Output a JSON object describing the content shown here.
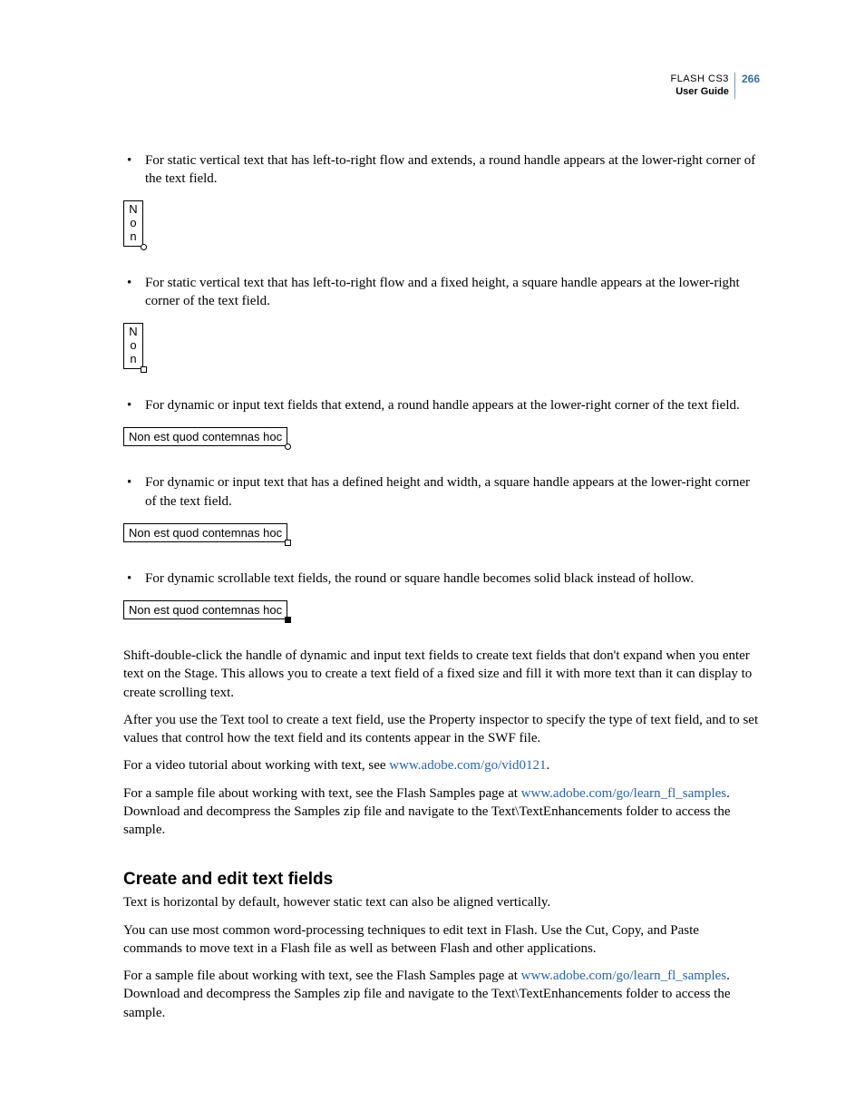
{
  "header": {
    "product": "FLASH CS3",
    "guide": "User Guide",
    "page": "266"
  },
  "bullets": {
    "b1": "For static vertical text that has left-to-right flow and extends, a round handle appears at the lower-right corner of the text field.",
    "b2": "For static vertical text that has left-to-right flow and a fixed height, a square handle appears at the lower-right corner of the text field.",
    "b3": "For dynamic or input text fields that extend, a round handle appears at the lower-right corner of the text field.",
    "b4": "For dynamic or input text that has a defined height and width, a square handle appears at the lower-right corner of the text field.",
    "b5": "For dynamic scrollable text fields, the round or square handle becomes solid black instead of hollow."
  },
  "figs": {
    "vertN": "N",
    "vertO": "o",
    "vertn": "n",
    "horiz": "Non est quod contemnas hoc"
  },
  "paras": {
    "p1": "Shift-double-click the handle of dynamic and input text fields to create text fields that don't expand when you enter text on the Stage. This allows you to create a text field of a fixed size and fill it with more text than it can display to create scrolling text.",
    "p2": "After you use the Text tool to create a text field, use the Property inspector to specify the type of text field, and to set values that control how the text field and its contents appear in the SWF file.",
    "p3a": "For a video tutorial about working with text, see ",
    "p3link": "www.adobe.com/go/vid0121",
    "p3b": ".",
    "p4a": "For a sample file about working with text, see the Flash Samples page at ",
    "p4link": "www.adobe.com/go/learn_fl_samples",
    "p4b": ". Download and decompress the Samples zip file and navigate to the Text\\TextEnhancements folder to access the sample."
  },
  "section2": {
    "title": "Create and edit text fields",
    "p1": "Text is horizontal by default, however static text can also be aligned vertically.",
    "p2": "You can use most common word-processing techniques to edit text in Flash. Use the Cut, Copy, and Paste commands to move text in a Flash file as well as between Flash and other applications.",
    "p3a": "For a sample file about working with text, see the Flash Samples page at ",
    "p3link": "www.adobe.com/go/learn_fl_samples",
    "p3b": ". Download and decompress the Samples zip file and navigate to the Text\\TextEnhancements folder to access the sample."
  }
}
